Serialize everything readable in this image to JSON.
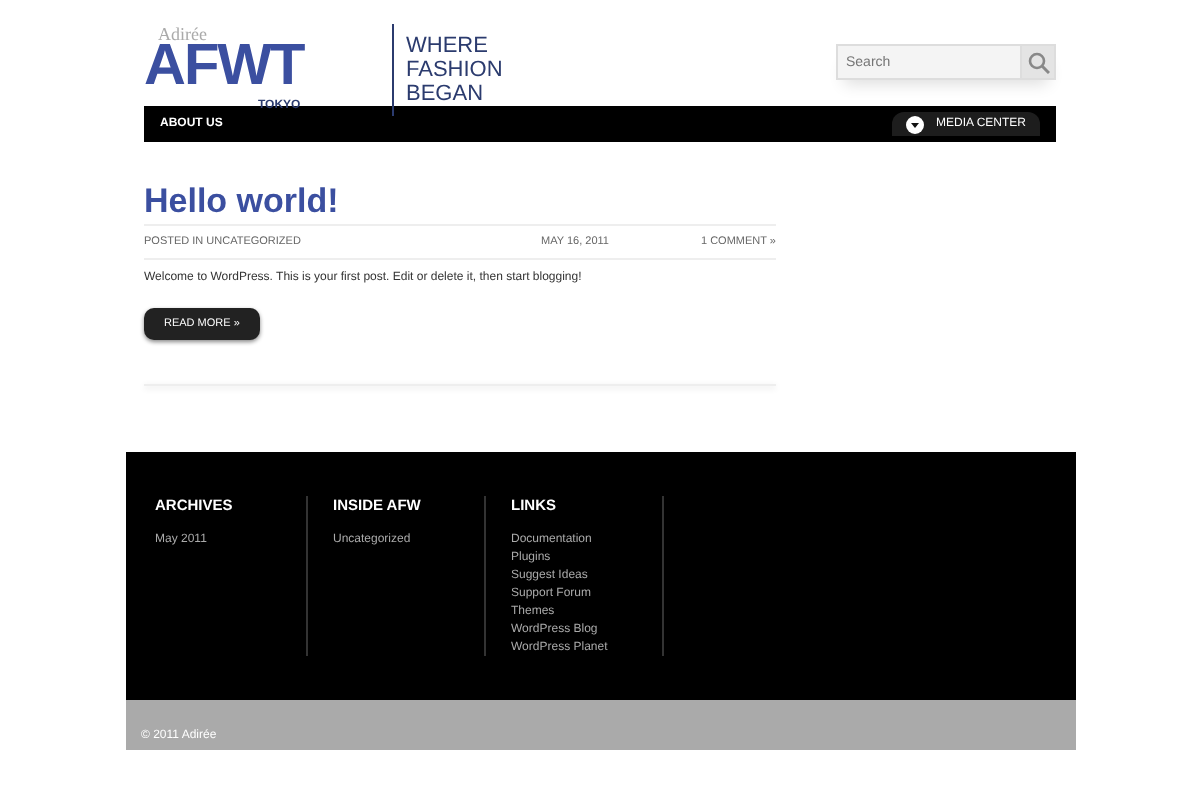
{
  "logo": {
    "script": "Adirée",
    "mark": "AFWT",
    "city": "TOKYO",
    "tagline": [
      "WHERE",
      "FASHION",
      "BEGAN"
    ]
  },
  "search": {
    "placeholder": "Search"
  },
  "nav": {
    "items": [
      "ABOUT US"
    ],
    "media_button": "MEDIA CENTER"
  },
  "post": {
    "title": "Hello world!",
    "category": "POSTED IN UNCATEGORIZED",
    "date": "MAY 16, 2011",
    "comments": "1 COMMENT »",
    "body": "Welcome to WordPress. This is your first post. Edit or delete it, then start blogging!",
    "read_more": "READ MORE »"
  },
  "footer": {
    "columns": [
      {
        "title": "ARCHIVES",
        "links": [
          "May 2011"
        ]
      },
      {
        "title": "INSIDE AFW",
        "links": [
          "Uncategorized"
        ]
      },
      {
        "title": "LINKS",
        "links": [
          "Documentation",
          "Plugins",
          "Suggest Ideas",
          "Support Forum",
          "Themes",
          "WordPress Blog",
          "WordPress Planet"
        ]
      }
    ],
    "copyright": "© 2011 Adirée"
  }
}
